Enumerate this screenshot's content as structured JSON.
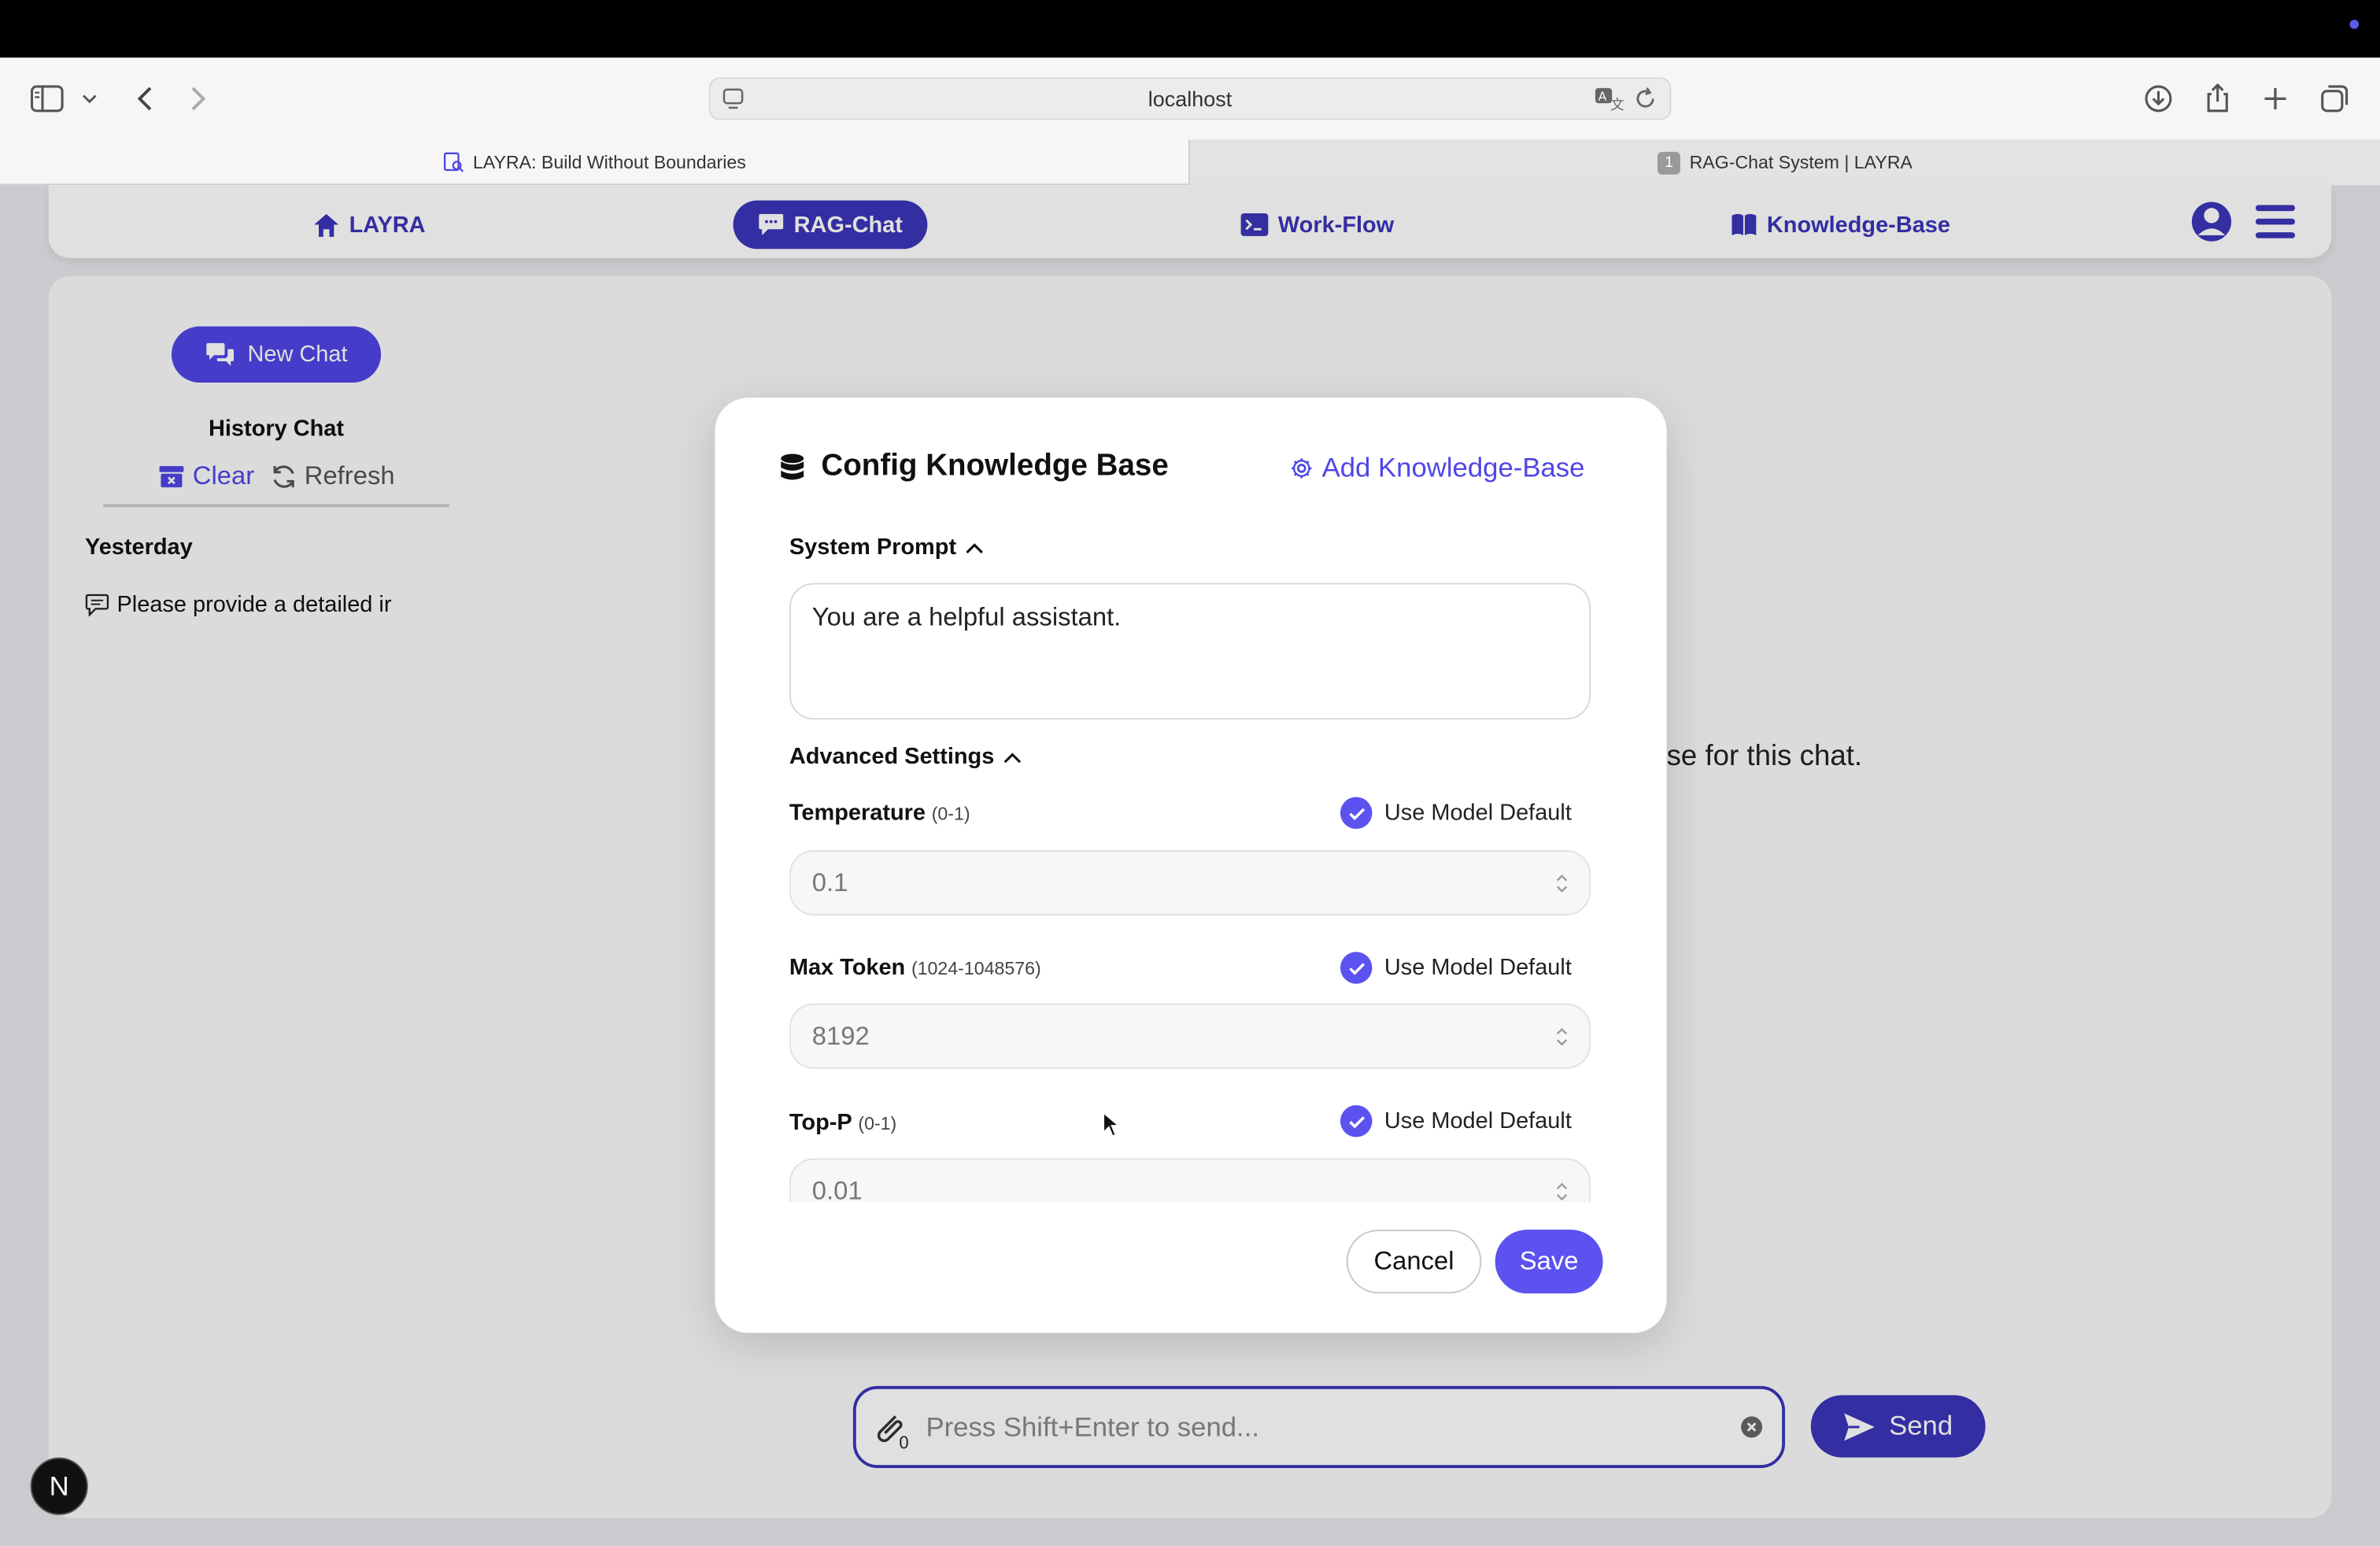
{
  "browser": {
    "address": "localhost",
    "tabs": [
      {
        "label": "LAYRA: Build Without Boundaries"
      },
      {
        "label": "RAG-Chat System | LAYRA",
        "badge": "1"
      }
    ]
  },
  "navbar": {
    "items": [
      {
        "label": "LAYRA",
        "icon": "home-icon"
      },
      {
        "label": "RAG-Chat",
        "icon": "chat-icon",
        "active": true
      },
      {
        "label": "Work-Flow",
        "icon": "terminal-icon"
      },
      {
        "label": "Knowledge-Base",
        "icon": "book-icon"
      }
    ]
  },
  "sidebar": {
    "new_chat": "New Chat",
    "history_title": "History Chat",
    "clear": "Clear",
    "refresh": "Refresh",
    "group": "Yesterday",
    "items": [
      {
        "label": "Please provide a detailed ir"
      }
    ]
  },
  "main": {
    "hint_fragment": "se for this chat.",
    "input_placeholder": "Press Shift+Enter to send...",
    "attachment_count": "0",
    "send": "Send"
  },
  "modal": {
    "title": "Config Knowledge Base",
    "add_kb": "Add Knowledge-Base",
    "system_prompt_label": "System Prompt",
    "system_prompt_value": "You are a helpful assistant.",
    "advanced_label": "Advanced Settings",
    "use_default": "Use Model Default",
    "fields": [
      {
        "label": "Temperature",
        "range": "(0-1)",
        "value": "0.1"
      },
      {
        "label": "Max Token",
        "range": "(1024-1048576)",
        "value": "8192"
      },
      {
        "label": "Top-P",
        "range": "(0-1)",
        "value": "0.01"
      }
    ],
    "cancel": "Cancel",
    "save": "Save"
  },
  "badge": "N",
  "colors": {
    "primary": "#3b35b8",
    "accent": "#5b52f0"
  }
}
